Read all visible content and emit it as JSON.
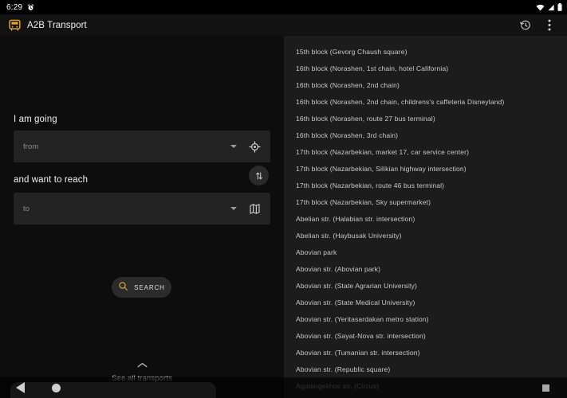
{
  "status_bar": {
    "time": "6:29",
    "left_icon": "alarm-clock-icon",
    "right_icons": [
      "wifi-icon",
      "signal-icon",
      "battery-icon"
    ]
  },
  "app_bar": {
    "logo_icon": "bus-icon",
    "title": "A2B Transport",
    "actions": [
      {
        "name": "history-icon",
        "label": "History"
      },
      {
        "name": "overflow-menu-icon",
        "label": "More options"
      }
    ]
  },
  "form": {
    "from_label": "I am going",
    "from_placeholder": "from",
    "from_dropdown_icon": "chevron-down-icon",
    "from_action_icon": "my-location-icon",
    "to_label": "and want to reach",
    "to_placeholder": "to",
    "to_dropdown_icon": "chevron-down-icon",
    "to_action_icon": "map-icon",
    "swap_icon": "swap-vertical-icon",
    "search_label": "SEARCH",
    "search_icon": "search-icon",
    "see_all_label": "See all transports",
    "see_all_icon": "chevron-up-icon"
  },
  "stops": [
    {
      "label": "15th block (Gevorg Chaush square)",
      "dim": false
    },
    {
      "label": "16th block (Norashen, 1st chain, hotel California)",
      "dim": false
    },
    {
      "label": "16th block (Norashen, 2nd chain)",
      "dim": false
    },
    {
      "label": "16th block (Norashen, 2nd chain, childrens's caffeteria Disneyland)",
      "dim": false
    },
    {
      "label": "16th block (Norashen, route 27 bus terminal)",
      "dim": false
    },
    {
      "label": "16th block (Norashen, 3rd chain)",
      "dim": false
    },
    {
      "label": "17th block (Nazarbekian, market 17, car service center)",
      "dim": false
    },
    {
      "label": "17th block (Nazarbekian,   Silikian highway intersection)",
      "dim": false
    },
    {
      "label": "17th block (Nazarbekian, route 46 bus terminal)",
      "dim": false
    },
    {
      "label": "17th block (Nazarbekian, Sky supermarket)",
      "dim": false
    },
    {
      "label": "Abelian str. (Halabian str. intersection)",
      "dim": false
    },
    {
      "label": "Abelian str. (Haybusak University)",
      "dim": false
    },
    {
      "label": "Abovian park",
      "dim": false
    },
    {
      "label": "Abovian str. (Abovian park)",
      "dim": false
    },
    {
      "label": "Abovian str. (State Agrarian University)",
      "dim": false
    },
    {
      "label": "Abovian str. (State Medical University)",
      "dim": false
    },
    {
      "label": "Abovian str. (Yeritasardakan metro station)",
      "dim": false
    },
    {
      "label": "Abovian str. (Sayat-Nova str. intersection)",
      "dim": false
    },
    {
      "label": "Abovian str. (Tumanian str. intersection)",
      "dim": false
    },
    {
      "label": "Abovian str. (Republic square)",
      "dim": false
    },
    {
      "label": "Agatangekhos str. (Circus)",
      "dim": true
    }
  ],
  "nav_bar": {
    "back_icon": "back-triangle-icon",
    "home_icon": "home-circle-icon",
    "recents_icon": "recents-square-icon"
  },
  "colors": {
    "accent": "#e0a43a",
    "left_bg": "#0d0d0d",
    "right_bg": "#1c1c1c",
    "field_bg": "#232323"
  }
}
